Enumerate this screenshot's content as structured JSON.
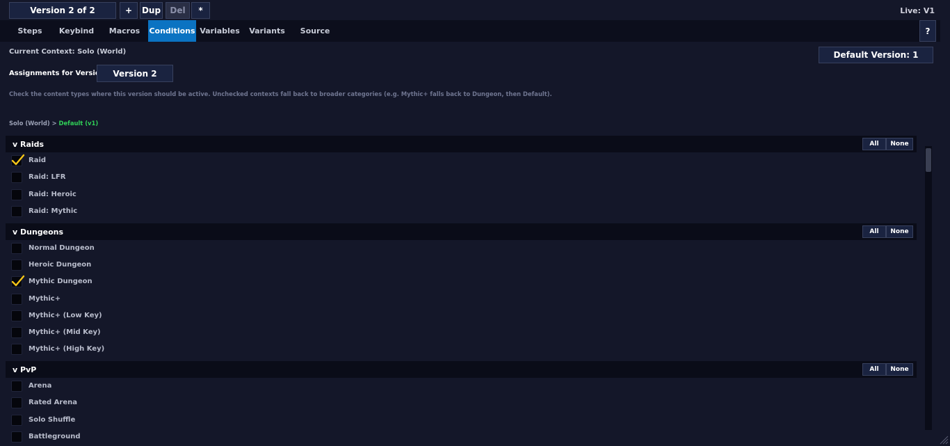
{
  "header": {
    "version_label": "Version 2 of 2",
    "add_label": "+",
    "dup_label": "Dup",
    "del_label": "Del",
    "star_label": "*",
    "live_label": "Live: V1"
  },
  "tabs": [
    {
      "label": "Steps"
    },
    {
      "label": "Keybind"
    },
    {
      "label": "Macros"
    },
    {
      "label": "Conditions",
      "active": true
    },
    {
      "label": "Variables"
    },
    {
      "label": "Variants"
    },
    {
      "label": "Source"
    }
  ],
  "help_label": "?",
  "context": {
    "current": "Current Context: Solo (World)",
    "default_version": "Default Version: 1",
    "assignments_label": "Assignments for Version 2",
    "version_button": "Version 2",
    "help_text": "Check the content types where this version should be active. Unchecked contexts fall back to broader categories (e.g. Mythic+ falls back to Dungeon, then Default).",
    "breadcrumb_from": "Solo (World)",
    "breadcrumb_sep": ">",
    "breadcrumb_to": "Default (v1)"
  },
  "sections": [
    {
      "title": "v Raids",
      "all": "All",
      "none": "None",
      "items": [
        {
          "label": "Raid",
          "checked": true
        },
        {
          "label": "Raid: LFR",
          "checked": false
        },
        {
          "label": "Raid: Heroic",
          "checked": false
        },
        {
          "label": "Raid: Mythic",
          "checked": false
        }
      ]
    },
    {
      "title": "v Dungeons",
      "all": "All",
      "none": "None",
      "items": [
        {
          "label": "Normal Dungeon",
          "checked": false
        },
        {
          "label": "Heroic Dungeon",
          "checked": false
        },
        {
          "label": "Mythic Dungeon",
          "checked": true
        },
        {
          "label": "Mythic+",
          "checked": false
        },
        {
          "label": "Mythic+ (Low Key)",
          "checked": false
        },
        {
          "label": "Mythic+ (Mid Key)",
          "checked": false
        },
        {
          "label": "Mythic+ (High Key)",
          "checked": false
        }
      ]
    },
    {
      "title": "v PvP",
      "all": "All",
      "none": "None",
      "items": [
        {
          "label": "Arena",
          "checked": false
        },
        {
          "label": "Rated Arena",
          "checked": false
        },
        {
          "label": "Solo Shuffle",
          "checked": false
        },
        {
          "label": "Battleground",
          "checked": false
        }
      ]
    }
  ],
  "colors": {
    "background": "#141729",
    "active_tab": "#0b73c2",
    "breadcrumb_default": "#30d158",
    "check": "#f5c518"
  }
}
